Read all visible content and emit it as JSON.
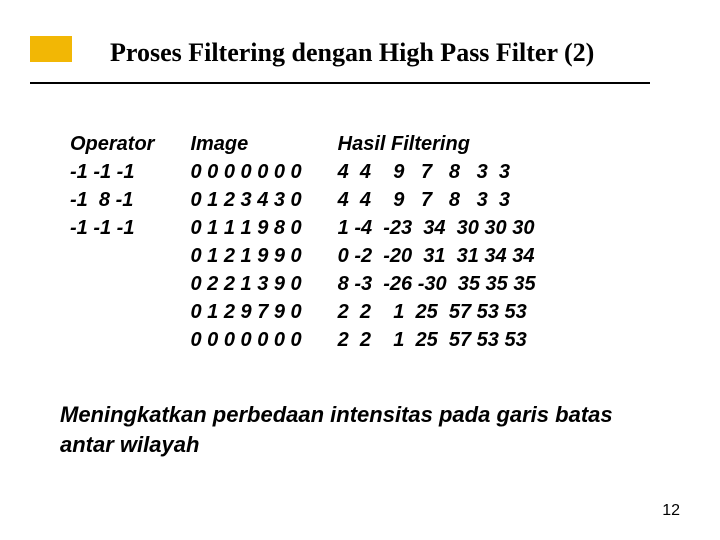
{
  "title": "Proses Filtering dengan High Pass Filter (2)",
  "columns": {
    "operator": "Operator\n-1 -1 -1\n-1  8 -1\n-1 -1 -1",
    "image": "Image\n0 0 0 0 0 0 0\n0 1 2 3 4 3 0\n0 1 1 1 9 8 0\n0 1 2 1 9 9 0\n0 2 2 1 3 9 0\n0 1 2 9 7 9 0\n0 0 0 0 0 0 0",
    "result": "Hasil Filtering\n4  4    9   7   8   3  3\n4  4    9   7   8   3  3\n1 -4  -23  34  30 30 30\n0 -2  -20  31  31 34 34\n8 -3  -26 -30  35 35 35\n2  2    1  25  57 53 53\n2  2    1  25  57 53 53"
  },
  "caption": "Meningkatkan perbedaan intensitas pada garis batas antar wilayah",
  "page_number": "12",
  "chart_data": {
    "type": "table",
    "title": "High Pass Filter example",
    "operator_kernel": [
      [
        -1,
        -1,
        -1
      ],
      [
        -1,
        8,
        -1
      ],
      [
        -1,
        -1,
        -1
      ]
    ],
    "input_image": [
      [
        0,
        0,
        0,
        0,
        0,
        0,
        0
      ],
      [
        0,
        1,
        2,
        3,
        4,
        3,
        0
      ],
      [
        0,
        1,
        1,
        1,
        9,
        8,
        0
      ],
      [
        0,
        1,
        2,
        1,
        9,
        9,
        0
      ],
      [
        0,
        2,
        2,
        1,
        3,
        9,
        0
      ],
      [
        0,
        1,
        2,
        9,
        7,
        9,
        0
      ],
      [
        0,
        0,
        0,
        0,
        0,
        0,
        0
      ]
    ],
    "filtered_result": [
      [
        4,
        4,
        9,
        7,
        8,
        3,
        3
      ],
      [
        4,
        4,
        9,
        7,
        8,
        3,
        3
      ],
      [
        1,
        -4,
        -23,
        34,
        30,
        30,
        30
      ],
      [
        0,
        -2,
        -20,
        31,
        31,
        34,
        34
      ],
      [
        8,
        -3,
        -26,
        -30,
        35,
        35,
        35
      ],
      [
        2,
        2,
        1,
        25,
        57,
        53,
        53
      ],
      [
        2,
        2,
        1,
        25,
        57,
        53,
        53
      ]
    ]
  }
}
